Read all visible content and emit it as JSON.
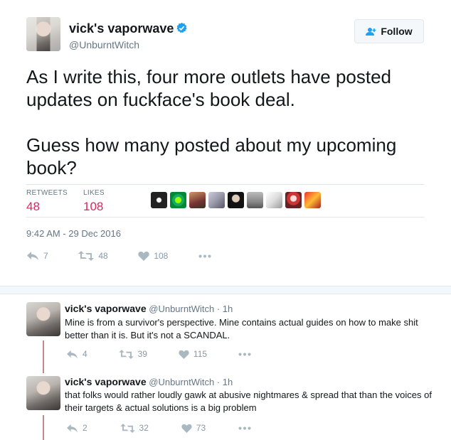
{
  "tweet": {
    "author_name": "vick's vaporwave",
    "author_handle": "@UnburntWitch",
    "follow_label": "Follow",
    "text": "As I write this, four more outlets have posted updates on fuckface's book deal.\n\nGuess how many posted about my upcoming book?",
    "stats": {
      "retweets_label": "RETWEETS",
      "retweets_value": "48",
      "likes_label": "LIKES",
      "likes_value": "108"
    },
    "timestamp": "9:42 AM - 29 Dec 2016",
    "actions": {
      "reply_count": "7",
      "retweet_count": "48",
      "like_count": "108"
    }
  },
  "replies": [
    {
      "author_name": "vick's vaporwave",
      "meta": "@UnburntWitch · 1h",
      "text": "Mine is from a survivor's perspective. Mine contains actual guides on how to make shit better than it is. But it's not a SCANDAL.",
      "reply_count": "4",
      "retweet_count": "39",
      "like_count": "115"
    },
    {
      "author_name": "vick's vaporwave",
      "meta": "@UnburntWitch · 1h",
      "text": "that folks would rather loudly gawk at abusive nightmares & spread that than the voices of their targets & actual solutions is a big problem",
      "reply_count": "2",
      "retweet_count": "32",
      "like_count": "73"
    }
  ],
  "colors": {
    "accent": "#1da1f2",
    "like_red": "#e0245e",
    "muted": "#657786"
  },
  "icons": [
    "verified-badge-icon",
    "follow-user-icon",
    "reply-icon",
    "retweet-icon",
    "heart-icon",
    "more-icon"
  ]
}
